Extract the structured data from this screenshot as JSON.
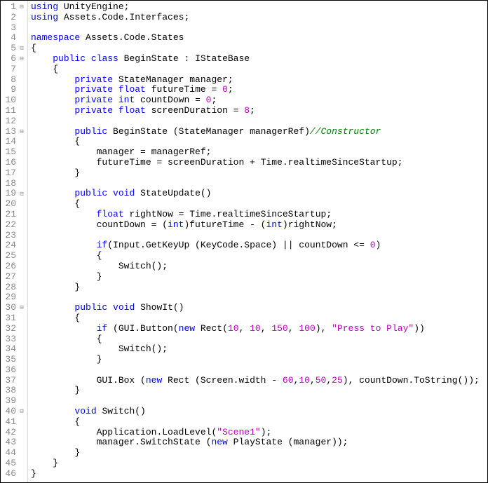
{
  "lines": [
    {
      "n": 1,
      "fold": "-",
      "seg": [
        [
          "kw",
          "using"
        ],
        [
          "",
          " UnityEngine;"
        ]
      ]
    },
    {
      "n": 2,
      "fold": "",
      "seg": [
        [
          "kw",
          "using"
        ],
        [
          "",
          " Assets"
        ],
        [
          "",
          ".Code"
        ],
        [
          "",
          ".Interfaces;"
        ]
      ]
    },
    {
      "n": 3,
      "fold": "",
      "seg": [
        [
          "",
          ""
        ]
      ]
    },
    {
      "n": 4,
      "fold": "",
      "seg": [
        [
          "kw",
          "namespace"
        ],
        [
          "",
          " Assets"
        ],
        [
          "",
          ".Code"
        ],
        [
          "",
          ".States"
        ]
      ]
    },
    {
      "n": 5,
      "fold": "-",
      "seg": [
        [
          "",
          "{"
        ]
      ]
    },
    {
      "n": 6,
      "fold": "-",
      "seg": [
        [
          "",
          "    "
        ],
        [
          "kw",
          "public"
        ],
        [
          "",
          " "
        ],
        [
          "kw",
          "class"
        ],
        [
          "",
          " BeginState : IStateBase"
        ]
      ]
    },
    {
      "n": 7,
      "fold": "",
      "seg": [
        [
          "",
          "    {"
        ]
      ]
    },
    {
      "n": 8,
      "fold": "",
      "seg": [
        [
          "",
          "        "
        ],
        [
          "kw",
          "private"
        ],
        [
          "",
          " StateManager manager;"
        ]
      ]
    },
    {
      "n": 9,
      "fold": "",
      "seg": [
        [
          "",
          "        "
        ],
        [
          "kw",
          "private"
        ],
        [
          "",
          " "
        ],
        [
          "kw",
          "float"
        ],
        [
          "",
          " futureTime = "
        ],
        [
          "num",
          "0"
        ],
        [
          "",
          ";"
        ]
      ]
    },
    {
      "n": 10,
      "fold": "",
      "seg": [
        [
          "",
          "        "
        ],
        [
          "kw",
          "private"
        ],
        [
          "",
          " "
        ],
        [
          "kw",
          "int"
        ],
        [
          "",
          " countDown = "
        ],
        [
          "num",
          "0"
        ],
        [
          "",
          ";"
        ]
      ]
    },
    {
      "n": 11,
      "fold": "",
      "seg": [
        [
          "",
          "        "
        ],
        [
          "kw",
          "private"
        ],
        [
          "",
          " "
        ],
        [
          "kw",
          "float"
        ],
        [
          "",
          " screenDuration = "
        ],
        [
          "num",
          "8"
        ],
        [
          "",
          ";"
        ]
      ]
    },
    {
      "n": 12,
      "fold": "",
      "seg": [
        [
          "",
          ""
        ]
      ]
    },
    {
      "n": 13,
      "fold": "-",
      "seg": [
        [
          "",
          "        "
        ],
        [
          "kw",
          "public"
        ],
        [
          "",
          " BeginState (StateManager managerRef)"
        ],
        [
          "comment",
          "//Constructor"
        ]
      ]
    },
    {
      "n": 14,
      "fold": "",
      "seg": [
        [
          "",
          "        {"
        ]
      ]
    },
    {
      "n": 15,
      "fold": "",
      "seg": [
        [
          "",
          "            manager = managerRef;"
        ]
      ]
    },
    {
      "n": 16,
      "fold": "",
      "seg": [
        [
          "",
          "            futureTime = screenDuration + Time"
        ],
        [
          "",
          ".realtimeSinceStartup;"
        ]
      ]
    },
    {
      "n": 17,
      "fold": "",
      "seg": [
        [
          "",
          "        }"
        ]
      ]
    },
    {
      "n": 18,
      "fold": "",
      "seg": [
        [
          "",
          ""
        ]
      ]
    },
    {
      "n": 19,
      "fold": "-",
      "seg": [
        [
          "",
          "        "
        ],
        [
          "kw",
          "public"
        ],
        [
          "",
          " "
        ],
        [
          "kw",
          "void"
        ],
        [
          "",
          " StateUpdate()"
        ]
      ]
    },
    {
      "n": 20,
      "fold": "",
      "seg": [
        [
          "",
          "        {"
        ]
      ]
    },
    {
      "n": 21,
      "fold": "",
      "seg": [
        [
          "",
          "            "
        ],
        [
          "kw",
          "float"
        ],
        [
          "",
          " rightNow = Time"
        ],
        [
          "",
          ".realtimeSinceStartup;"
        ]
      ]
    },
    {
      "n": 22,
      "fold": "",
      "seg": [
        [
          "",
          "            countDown = ("
        ],
        [
          "kw",
          "int"
        ],
        [
          "",
          ")futureTime - ("
        ],
        [
          "kw",
          "int"
        ],
        [
          "",
          ")rightNow;"
        ]
      ]
    },
    {
      "n": 23,
      "fold": "",
      "seg": [
        [
          "",
          ""
        ]
      ]
    },
    {
      "n": 24,
      "fold": "",
      "seg": [
        [
          "",
          "            "
        ],
        [
          "kw",
          "if"
        ],
        [
          "",
          "(Input"
        ],
        [
          "",
          ".GetKeyUp (KeyCode"
        ],
        [
          "",
          ".Space) || countDown <= "
        ],
        [
          "num",
          "0"
        ],
        [
          "",
          ")"
        ]
      ]
    },
    {
      "n": 25,
      "fold": "",
      "seg": [
        [
          "",
          "            {"
        ]
      ]
    },
    {
      "n": 26,
      "fold": "",
      "seg": [
        [
          "",
          "                Switch();"
        ]
      ]
    },
    {
      "n": 27,
      "fold": "",
      "seg": [
        [
          "",
          "            }"
        ]
      ]
    },
    {
      "n": 28,
      "fold": "",
      "seg": [
        [
          "",
          "        }"
        ]
      ]
    },
    {
      "n": 29,
      "fold": "",
      "seg": [
        [
          "",
          ""
        ]
      ]
    },
    {
      "n": 30,
      "fold": "-",
      "seg": [
        [
          "",
          "        "
        ],
        [
          "kw",
          "public"
        ],
        [
          "",
          " "
        ],
        [
          "kw",
          "void"
        ],
        [
          "",
          " ShowIt()"
        ]
      ]
    },
    {
      "n": 31,
      "fold": "",
      "seg": [
        [
          "",
          "        {"
        ]
      ]
    },
    {
      "n": 32,
      "fold": "",
      "seg": [
        [
          "",
          "            "
        ],
        [
          "kw",
          "if"
        ],
        [
          "",
          " (GUI"
        ],
        [
          "",
          ".Button("
        ],
        [
          "kw",
          "new"
        ],
        [
          "",
          " Rect("
        ],
        [
          "num",
          "10"
        ],
        [
          "",
          ", "
        ],
        [
          "num",
          "10"
        ],
        [
          "",
          ", "
        ],
        [
          "num",
          "150"
        ],
        [
          "",
          ", "
        ],
        [
          "num",
          "100"
        ],
        [
          "",
          "), "
        ],
        [
          "str",
          "\"Press to Play\""
        ],
        [
          "",
          "))"
        ]
      ]
    },
    {
      "n": 33,
      "fold": "",
      "seg": [
        [
          "",
          "            {"
        ]
      ]
    },
    {
      "n": 34,
      "fold": "",
      "seg": [
        [
          "",
          "                Switch();"
        ]
      ]
    },
    {
      "n": 35,
      "fold": "",
      "seg": [
        [
          "",
          "            }"
        ]
      ]
    },
    {
      "n": 36,
      "fold": "",
      "seg": [
        [
          "",
          ""
        ]
      ]
    },
    {
      "n": 37,
      "fold": "",
      "seg": [
        [
          "",
          "            GUI"
        ],
        [
          "",
          ".Box ("
        ],
        [
          "kw",
          "new"
        ],
        [
          "",
          " Rect (Screen"
        ],
        [
          "",
          ".width - "
        ],
        [
          "num",
          "60"
        ],
        [
          "",
          ","
        ],
        [
          "num",
          "10"
        ],
        [
          "",
          ","
        ],
        [
          "num",
          "50"
        ],
        [
          "",
          ","
        ],
        [
          "num",
          "25"
        ],
        [
          "",
          "), countDown"
        ],
        [
          "",
          ".ToString());"
        ]
      ]
    },
    {
      "n": 38,
      "fold": "",
      "seg": [
        [
          "",
          "        }"
        ]
      ]
    },
    {
      "n": 39,
      "fold": "",
      "seg": [
        [
          "",
          ""
        ]
      ]
    },
    {
      "n": 40,
      "fold": "-",
      "seg": [
        [
          "",
          "        "
        ],
        [
          "kw",
          "void"
        ],
        [
          "",
          " Switch()"
        ]
      ]
    },
    {
      "n": 41,
      "fold": "",
      "seg": [
        [
          "",
          "        {"
        ]
      ]
    },
    {
      "n": 42,
      "fold": "",
      "seg": [
        [
          "",
          "            Application"
        ],
        [
          "",
          ".LoadLevel("
        ],
        [
          "str",
          "\"Scene1\""
        ],
        [
          "",
          ");"
        ]
      ]
    },
    {
      "n": 43,
      "fold": "",
      "seg": [
        [
          "",
          "            manager"
        ],
        [
          "",
          ".SwitchState ("
        ],
        [
          "kw",
          "new"
        ],
        [
          "",
          " PlayState (manager));"
        ]
      ]
    },
    {
      "n": 44,
      "fold": "",
      "seg": [
        [
          "",
          "        }"
        ]
      ]
    },
    {
      "n": 45,
      "fold": "",
      "seg": [
        [
          "",
          "    }"
        ]
      ]
    },
    {
      "n": 46,
      "fold": "",
      "seg": [
        [
          "",
          "}"
        ]
      ]
    }
  ]
}
